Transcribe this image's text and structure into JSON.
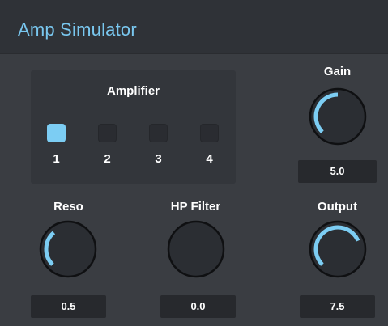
{
  "header": {
    "title": "Amp Simulator"
  },
  "accent_color": "#7ccdf3",
  "amplifier": {
    "label": "Amplifier",
    "selected": 1,
    "options": [
      "1",
      "2",
      "3",
      "4"
    ]
  },
  "knobs": {
    "gain": {
      "label": "Gain",
      "value": "5.0",
      "level": 0.5
    },
    "reso": {
      "label": "Reso",
      "value": "0.5",
      "level": 0.35
    },
    "hp_filter": {
      "label": "HP Filter",
      "value": "0.0",
      "level": 0.0
    },
    "output": {
      "label": "Output",
      "value": "7.5",
      "level": 0.75
    }
  }
}
